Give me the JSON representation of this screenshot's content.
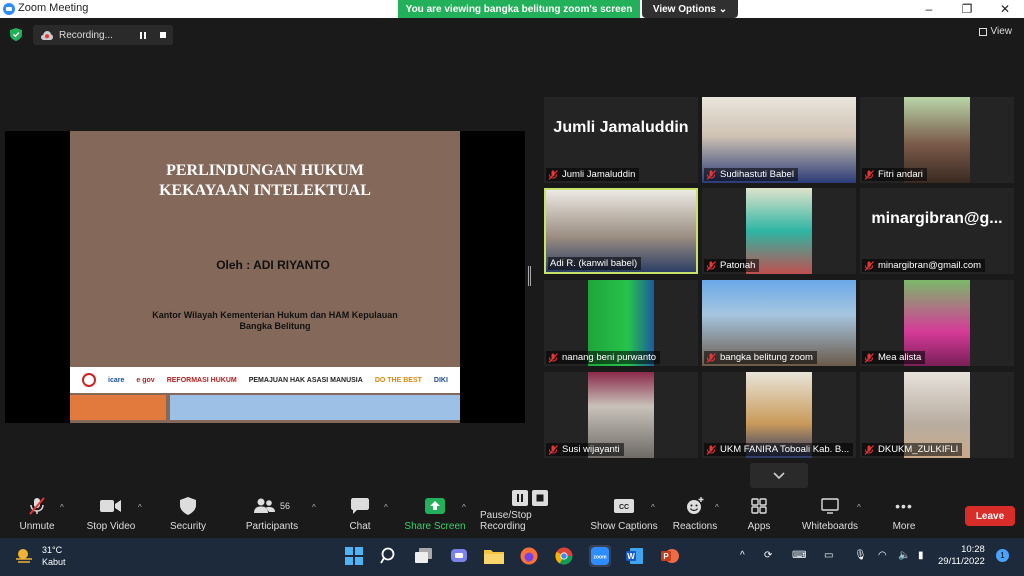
{
  "window": {
    "title": "Zoom Meeting",
    "controls": [
      "–",
      "❐",
      "✕"
    ]
  },
  "share_banner": {
    "text": "You are viewing bangka belitung zoom's screen",
    "view_options": "View Options ⌄"
  },
  "top_bar": {
    "recording_label": "Recording...",
    "view_label": "View"
  },
  "slide": {
    "title_line1": "PERLINDUNGAN HUKUM",
    "title_line2": "KEKAYAAN INTELEKTUAL",
    "author": "Oleh : ADI RIYANTO",
    "office_line1": "Kantor Wilayah Kementerian Hukum dan HAM Kepulauan",
    "office_line2": "Bangka Belitung",
    "logos": [
      "icare",
      "e gov",
      "REFORMASI HUKUM",
      "PEMAJUAN HAK ASASI MANUSIA",
      "DO THE BEST",
      "DIKI"
    ]
  },
  "participants": [
    {
      "name": "Jumli Jamaluddin",
      "display_text": "Jumli Jamaluddin",
      "video": false
    },
    {
      "name": "Sudihastuti Babel",
      "video": true
    },
    {
      "name": "Fitri andari",
      "video": true
    },
    {
      "name": "Adi R. (kanwil babel)",
      "video": true,
      "active": true
    },
    {
      "name": "Patonah",
      "video": true
    },
    {
      "name": "minargibran@gmail.com",
      "display_text": "minargibran@g...",
      "video": false
    },
    {
      "name": "nanang beni purwanto",
      "video": true
    },
    {
      "name": "bangka belitung zoom",
      "video": true
    },
    {
      "name": "Mea alista",
      "video": true
    },
    {
      "name": "Susi wijayanti",
      "video": true
    },
    {
      "name": "UKM FANIRA Toboali Kab. B...",
      "video": true
    },
    {
      "name": "DKUKM_ZULKIFLI",
      "video": true
    }
  ],
  "toolbar": {
    "unmute": "Unmute",
    "stop_video": "Stop Video",
    "security": "Security",
    "participants": "Participants",
    "participant_count": "56",
    "chat": "Chat",
    "share_screen": "Share Screen",
    "recording": "Pause/Stop Recording",
    "captions": "Show Captions",
    "reactions": "Reactions",
    "apps": "Apps",
    "whiteboards": "Whiteboards",
    "more": "More",
    "leave": "Leave"
  },
  "taskbar": {
    "temperature": "31°C",
    "weather": "Kabut",
    "time": "10:28",
    "date": "29/11/2022",
    "notification_count": "1"
  },
  "colors": {
    "share_green": "#23b05a",
    "leave_red": "#d92d2a",
    "active_speaker": "#c7e26a",
    "slide_brown": "#84695a"
  }
}
